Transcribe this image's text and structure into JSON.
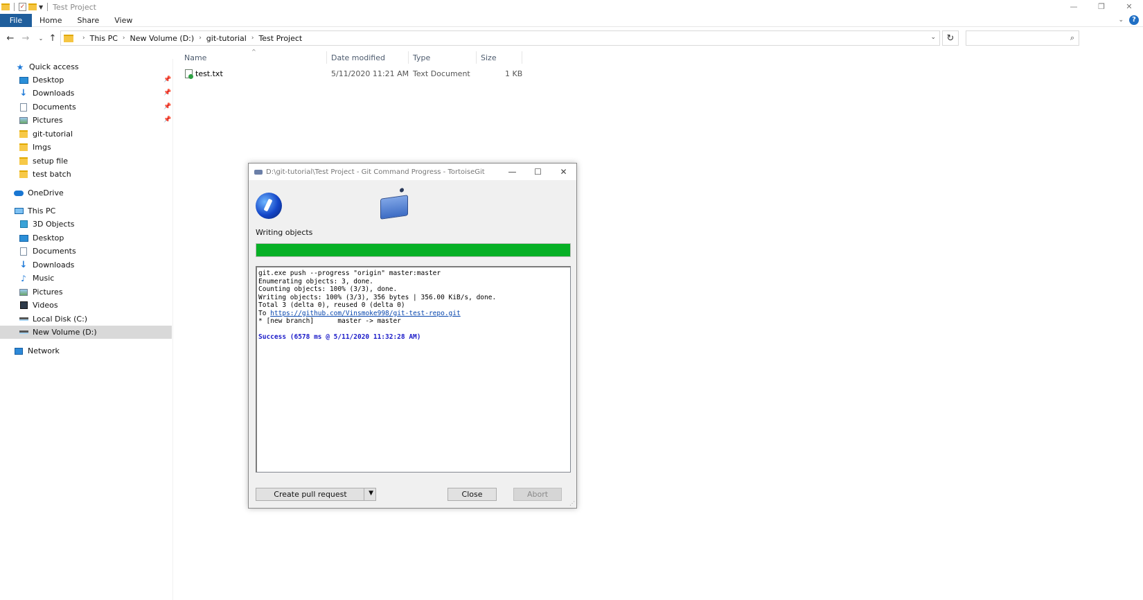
{
  "explorer": {
    "title": "Test Project",
    "ribbon_tabs": [
      "File",
      "Home",
      "Share",
      "View"
    ],
    "breadcrumbs": [
      "This PC",
      "New Volume (D:)",
      "git-tutorial",
      "Test Project"
    ],
    "search_placeholder": ""
  },
  "nav": {
    "quick_access": "Quick access",
    "qa_items": [
      "Desktop",
      "Downloads",
      "Documents",
      "Pictures",
      "git-tutorial",
      "Imgs",
      "setup file",
      "test batch"
    ],
    "onedrive": "OneDrive",
    "this_pc": "This PC",
    "pc_items": [
      "3D Objects",
      "Desktop",
      "Documents",
      "Downloads",
      "Music",
      "Pictures",
      "Videos",
      "Local Disk (C:)",
      "New Volume (D:)"
    ],
    "network": "Network"
  },
  "filelist": {
    "columns": [
      "Name",
      "Date modified",
      "Type",
      "Size"
    ],
    "rows": [
      {
        "name": "test.txt",
        "date": "5/11/2020 11:21 AM",
        "type": "Text Document",
        "size": "1 KB"
      }
    ]
  },
  "dialog": {
    "title": "D:\\git-tutorial\\Test Project - Git Command Progress - TortoiseGit",
    "status": "Writing objects",
    "progress": 1.0,
    "progress_color": "#06b025",
    "log": {
      "line1": "git.exe push --progress \"origin\" master:master",
      "line2": "Enumerating objects: 3, done.",
      "line3": "Counting objects: 100% (3/3), done.",
      "line4": "Writing objects: 100% (3/3), 356 bytes | 356.00 KiB/s, done.",
      "line5": "Total 3 (delta 0), reused 0 (delta 0)",
      "to_prefix": "To ",
      "url": "https://github.com/Vinsmoke998/git-test-repo.git",
      "line7": "* [new branch]      master -> master",
      "success": "Success (6578 ms @ 5/11/2020 11:32:28 AM)"
    },
    "buttons": {
      "pull_request": "Create pull request",
      "close": "Close",
      "abort": "Abort"
    }
  }
}
